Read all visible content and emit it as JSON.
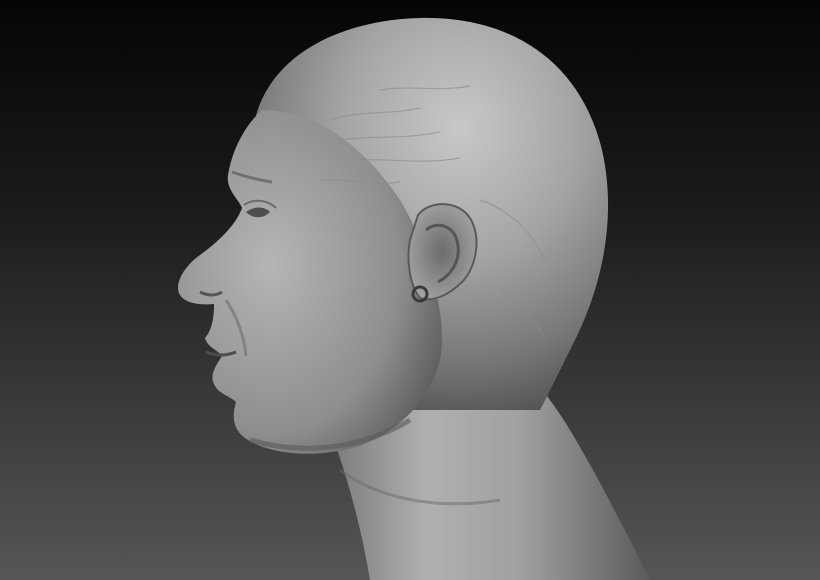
{
  "scene": {
    "subject": "sculpted-head-profile",
    "material": "grey-clay",
    "facing": "left",
    "colors": {
      "background_top": "#050505",
      "background_bottom": "#565656",
      "clay_light": "#b9b9b9",
      "clay_mid": "#8e8e8e",
      "clay_dark": "#4a4a4a"
    }
  }
}
